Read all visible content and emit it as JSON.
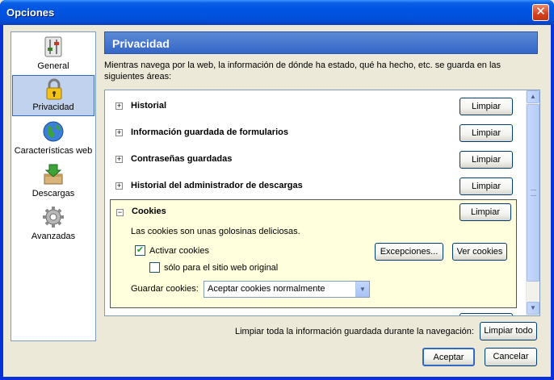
{
  "window": {
    "title": "Opciones",
    "close_glyph": "✕"
  },
  "sidebar": {
    "items": [
      {
        "label": "General",
        "icon": "general-sliders-icon",
        "selected": false
      },
      {
        "label": "Privacidad",
        "icon": "padlock-icon",
        "selected": true
      },
      {
        "label": "Características web",
        "icon": "globe-icon",
        "selected": false
      },
      {
        "label": "Descargas",
        "icon": "download-box-icon",
        "selected": false
      },
      {
        "label": "Avanzadas",
        "icon": "gear-icon",
        "selected": false
      }
    ]
  },
  "panel": {
    "title": "Privacidad",
    "intro": "Mientras navega por la web, la información de dónde ha estado, qué ha hecho, etc. se guarda en las siguientes áreas:",
    "rows": [
      {
        "title": "Historial",
        "button": "Limpiar",
        "expander": "+"
      },
      {
        "title": "Información guardada de formularios",
        "button": "Limpiar",
        "expander": "+"
      },
      {
        "title": "Contraseñas guardadas",
        "button": "Limpiar",
        "expander": "+"
      },
      {
        "title": "Historial del administrador de descargas",
        "button": "Limpiar",
        "expander": "+"
      }
    ],
    "cookies": {
      "title": "Cookies",
      "expander": "−",
      "button": "Limpiar",
      "description": "Las cookies son unas golosinas deliciosas.",
      "enable_label": "Activar cookies",
      "enable_checked": true,
      "check_glyph": "✔",
      "original_only_label": "sólo para el sitio web original",
      "original_only_checked": false,
      "exceptions_button": "Excepciones...",
      "view_button": "Ver cookies",
      "keep_label": "Guardar cookies:",
      "keep_value": "Aceptar cookies normalmente"
    }
  },
  "footer": {
    "clear_all_label": "Limpiar toda la información guardada durante la navegación:",
    "clear_all_button": "Limpiar todo",
    "ok_button": "Aceptar",
    "cancel_button": "Cancelar"
  },
  "glyphs": {
    "arrow_up": "▲",
    "arrow_down": "▼"
  }
}
